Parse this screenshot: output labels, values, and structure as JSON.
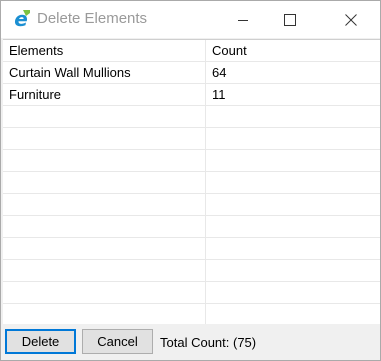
{
  "window": {
    "title": "Delete Elements"
  },
  "table": {
    "headers": [
      "Elements",
      "Count"
    ],
    "rows": [
      {
        "element": "Curtain Wall Mullions",
        "count": "64"
      },
      {
        "element": "Furniture",
        "count": "11"
      }
    ]
  },
  "footer": {
    "delete_label": "Delete",
    "cancel_label": "Cancel",
    "total_prefix": "Total Count:",
    "total_value": "(75)"
  },
  "colors": {
    "accent": "#0078d7",
    "icon_green": "#7cc242",
    "icon_blue": "#1b8fd2"
  },
  "icons": {
    "app": "e-logo-icon",
    "minimize": "minimize-icon",
    "maximize": "maximize-icon",
    "close": "close-icon"
  }
}
